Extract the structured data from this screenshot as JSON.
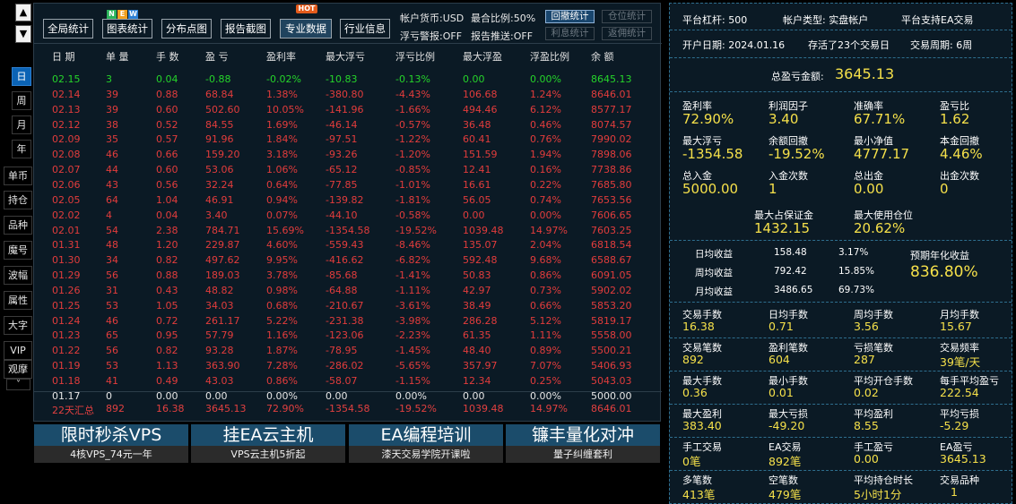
{
  "colors": {
    "up": "#e23c3c",
    "down": "#25d42a",
    "neutral": "#e6e6e6",
    "accent": "#f5e04a",
    "active_blue": "#0b63b5"
  },
  "left_nav": {
    "up_icon": "▲",
    "down_icon": "▼",
    "more_icon": "˅",
    "items": [
      "日",
      "周",
      "月",
      "年",
      "单币",
      "持仓",
      "品种",
      "魔号",
      "波幅",
      "属性",
      "大字",
      "VIP",
      "观摩"
    ]
  },
  "toolbar": {
    "buttons": [
      "全局统计",
      "图表统计",
      "分布点图",
      "报告截图",
      "专业数据",
      "行业信息"
    ],
    "new_badge": [
      "N",
      "E",
      "W"
    ],
    "hot_badge": "HOT",
    "status": {
      "currency": "帐户货币:USD",
      "max_ratio": "最合比例:50%",
      "float_warn": "浮亏警报:OFF",
      "report_push": "报告推送:OFF"
    },
    "small_buttons": [
      "回撤统计",
      "仓位统计",
      "利息统计",
      "返佣统计"
    ]
  },
  "table": {
    "headers": [
      "日 期",
      "单 量",
      "手 数",
      "盈 亏",
      "盈利率",
      "最大浮亏",
      "浮亏比例",
      "最大浮盈",
      "浮盈比例",
      "余 额"
    ],
    "rows": [
      {
        "c": [
          "02.15",
          "3",
          "0.04",
          "-0.88",
          "-0.02%",
          "-10.83",
          "-0.13%",
          "0.00",
          "0.00%",
          "8645.13"
        ],
        "s": "down"
      },
      {
        "c": [
          "02.14",
          "39",
          "0.88",
          "68.84",
          "1.38%",
          "-380.80",
          "-4.43%",
          "106.68",
          "1.24%",
          "8646.01"
        ],
        "s": "up"
      },
      {
        "c": [
          "02.13",
          "39",
          "0.60",
          "502.60",
          "10.05%",
          "-141.96",
          "-1.66%",
          "494.46",
          "6.12%",
          "8577.17"
        ],
        "s": "up"
      },
      {
        "c": [
          "02.12",
          "38",
          "0.52",
          "84.55",
          "1.69%",
          "-46.14",
          "-0.57%",
          "36.48",
          "0.46%",
          "8074.57"
        ],
        "s": "up"
      },
      {
        "c": [
          "02.09",
          "35",
          "0.57",
          "91.96",
          "1.84%",
          "-97.51",
          "-1.22%",
          "60.41",
          "0.76%",
          "7990.02"
        ],
        "s": "up"
      },
      {
        "c": [
          "02.08",
          "46",
          "0.66",
          "159.20",
          "3.18%",
          "-93.26",
          "-1.20%",
          "151.59",
          "1.94%",
          "7898.06"
        ],
        "s": "up"
      },
      {
        "c": [
          "02.07",
          "44",
          "0.60",
          "53.06",
          "1.06%",
          "-65.12",
          "-0.85%",
          "12.41",
          "0.16%",
          "7738.86"
        ],
        "s": "up"
      },
      {
        "c": [
          "02.06",
          "43",
          "0.56",
          "32.24",
          "0.64%",
          "-77.85",
          "-1.01%",
          "16.61",
          "0.22%",
          "7685.80"
        ],
        "s": "up"
      },
      {
        "c": [
          "02.05",
          "64",
          "1.04",
          "46.91",
          "0.94%",
          "-139.82",
          "-1.81%",
          "56.05",
          "0.74%",
          "7653.56"
        ],
        "s": "up"
      },
      {
        "c": [
          "02.02",
          "4",
          "0.04",
          "3.40",
          "0.07%",
          "-44.10",
          "-0.58%",
          "0.00",
          "0.00%",
          "7606.65"
        ],
        "s": "up"
      },
      {
        "c": [
          "02.01",
          "54",
          "2.38",
          "784.71",
          "15.69%",
          "-1354.58",
          "-19.52%",
          "1039.48",
          "14.97%",
          "7603.25"
        ],
        "s": "up"
      },
      {
        "c": [
          "01.31",
          "48",
          "1.20",
          "229.87",
          "4.60%",
          "-559.43",
          "-8.46%",
          "135.07",
          "2.04%",
          "6818.54"
        ],
        "s": "up"
      },
      {
        "c": [
          "01.30",
          "34",
          "0.82",
          "497.62",
          "9.95%",
          "-416.62",
          "-6.82%",
          "592.48",
          "9.68%",
          "6588.67"
        ],
        "s": "up"
      },
      {
        "c": [
          "01.29",
          "56",
          "0.88",
          "189.03",
          "3.78%",
          "-85.68",
          "-1.41%",
          "50.83",
          "0.86%",
          "6091.05"
        ],
        "s": "up"
      },
      {
        "c": [
          "01.26",
          "31",
          "0.43",
          "48.82",
          "0.98%",
          "-64.88",
          "-1.11%",
          "42.97",
          "0.73%",
          "5902.02"
        ],
        "s": "up"
      },
      {
        "c": [
          "01.25",
          "53",
          "1.05",
          "34.03",
          "0.68%",
          "-210.67",
          "-3.61%",
          "38.49",
          "0.66%",
          "5853.20"
        ],
        "s": "up"
      },
      {
        "c": [
          "01.24",
          "46",
          "0.72",
          "261.17",
          "5.22%",
          "-231.38",
          "-3.98%",
          "286.28",
          "5.12%",
          "5819.17"
        ],
        "s": "up"
      },
      {
        "c": [
          "01.23",
          "65",
          "0.95",
          "57.79",
          "1.16%",
          "-123.06",
          "-2.23%",
          "61.35",
          "1.11%",
          "5558.00"
        ],
        "s": "up"
      },
      {
        "c": [
          "01.22",
          "56",
          "0.82",
          "93.28",
          "1.87%",
          "-78.95",
          "-1.45%",
          "48.40",
          "0.89%",
          "5500.21"
        ],
        "s": "up"
      },
      {
        "c": [
          "01.19",
          "53",
          "1.13",
          "363.90",
          "7.28%",
          "-286.02",
          "-5.65%",
          "357.97",
          "7.07%",
          "5406.93"
        ],
        "s": "up"
      },
      {
        "c": [
          "01.18",
          "41",
          "0.49",
          "43.03",
          "0.86%",
          "-58.07",
          "-1.15%",
          "12.34",
          "0.25%",
          "5043.03"
        ],
        "s": "up"
      },
      {
        "c": [
          "01.17",
          "0",
          "0.00",
          "0.00",
          "0.00%",
          "0.00",
          "0.00%",
          "0.00",
          "0.00%",
          "5000.00"
        ],
        "s": "neutral"
      }
    ],
    "summary": [
      "22天汇总",
      "892",
      "16.38",
      "3645.13",
      "72.90%",
      "-1354.58",
      "-19.52%",
      "1039.48",
      "14.97%",
      "8646.01"
    ]
  },
  "ads": [
    {
      "title": "限时秒杀VPS",
      "sub": "4核VPS_74元一年"
    },
    {
      "title": "挂EA云主机",
      "sub": "VPS云主机5折起"
    },
    {
      "title": "EA编程培训",
      "sub": "漆天交易学院开课啦"
    },
    {
      "title": "镰丰量化对冲",
      "sub": "量子纠缠套利"
    }
  ],
  "stats": {
    "leverage": "平台杠杆:  500",
    "account_type": "帐户类型:  实盘帐户",
    "ea_support": "平台支持EA交易",
    "open_date": "开户日期:  2024.01.16",
    "survive": "存活了23个交易日",
    "cycle": "交易周期:  6周",
    "total_pl_label": "总盈亏金额:",
    "total_pl": "3645.13",
    "grid1": [
      {
        "l": "盈利率",
        "v": "72.90%"
      },
      {
        "l": "利润因子",
        "v": "3.40"
      },
      {
        "l": "准确率",
        "v": "67.71%"
      },
      {
        "l": "盈亏比",
        "v": "1.62"
      },
      {
        "l": "最大浮亏",
        "v": "-1354.58"
      },
      {
        "l": "余额回撤",
        "v": "-19.52%"
      },
      {
        "l": "最小净值",
        "v": "4777.17"
      },
      {
        "l": "本金回撤",
        "v": "4.46%"
      },
      {
        "l": "总入金",
        "v": "5000.00"
      },
      {
        "l": "入金次数",
        "v": "1"
      },
      {
        "l": "总出金",
        "v": "0.00"
      },
      {
        "l": "出金次数",
        "v": "0"
      }
    ],
    "margin": [
      {
        "l": "最大占保证金",
        "v": "1432.15"
      },
      {
        "l": "最大使用仓位",
        "v": "20.62%"
      }
    ],
    "avg": [
      {
        "l": "日均收益",
        "a": "158.48",
        "p": "3.17%"
      },
      {
        "l": "周均收益",
        "a": "792.42",
        "p": "15.85%"
      },
      {
        "l": "月均收益",
        "a": "3486.65",
        "p": "69.73%"
      }
    ],
    "annual_label": "预期年化收益",
    "annual": "836.80%",
    "grid2": [
      {
        "l": "交易手数",
        "v": "16.38"
      },
      {
        "l": "日均手数",
        "v": "0.71"
      },
      {
        "l": "周均手数",
        "v": "3.56"
      },
      {
        "l": "月均手数",
        "v": "15.67"
      },
      {
        "l": "交易笔数",
        "v": "892"
      },
      {
        "l": "盈利笔数",
        "v": "604"
      },
      {
        "l": "亏损笔数",
        "v": "287"
      },
      {
        "l": "交易频率",
        "v": "39笔/天"
      },
      {
        "l": "最大手数",
        "v": "0.36"
      },
      {
        "l": "最小手数",
        "v": "0.01"
      },
      {
        "l": "平均开仓手数",
        "v": "0.02"
      },
      {
        "l": "每手平均盈亏",
        "v": "222.54"
      },
      {
        "l": "最大盈利",
        "v": "383.40"
      },
      {
        "l": "最大亏损",
        "v": "-49.20"
      },
      {
        "l": "平均盈利",
        "v": "8.55"
      },
      {
        "l": "平均亏损",
        "v": "-5.29"
      },
      {
        "l": "手工交易",
        "v": "0笔"
      },
      {
        "l": "EA交易",
        "v": "892笔"
      },
      {
        "l": "手工盈亏",
        "v": "0.00"
      },
      {
        "l": "EA盈亏",
        "v": "3645.13"
      },
      {
        "l": "多笔数",
        "v": "413笔"
      },
      {
        "l": "空笔数",
        "v": "479笔"
      },
      {
        "l": "平均持仓时长",
        "v": "5小时1分"
      },
      {
        "l": "交易品种",
        "v": "1"
      }
    ]
  }
}
